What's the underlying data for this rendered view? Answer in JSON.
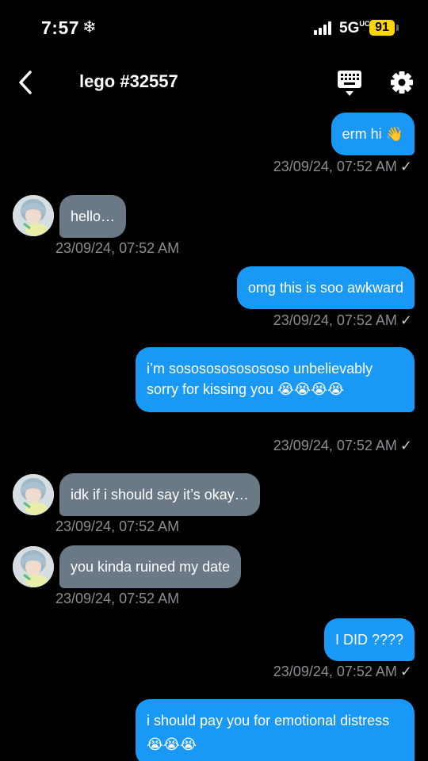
{
  "status": {
    "time": "7:57",
    "snow_glyph": "❄",
    "network": "5G",
    "network_sup": "UC",
    "battery": "91"
  },
  "header": {
    "title": "lego #32557",
    "back_icon": "chevron-left-icon",
    "keyboard_icon": "keyboard-icon",
    "settings_icon": "gear-icon"
  },
  "messages": [
    {
      "dir": "out",
      "text": "erm hi 👋",
      "time": "23/09/24, 07:52 AM",
      "read": "✓"
    },
    {
      "dir": "in",
      "text": "hello…",
      "time": "23/09/24, 07:52 AM"
    },
    {
      "dir": "out",
      "text": "omg this is soo awkward",
      "time": "23/09/24, 07:52 AM",
      "read": "✓"
    },
    {
      "dir": "out",
      "text": "i’m sosososososososo unbelievably sorry for kissing you 😭😭😭😭",
      "time": "23/09/24, 07:52 AM",
      "read": "✓"
    },
    {
      "dir": "in",
      "text": "idk if i should say it’s okay…",
      "time": "23/09/24, 07:52 AM"
    },
    {
      "dir": "in",
      "text": "you kinda ruined my date",
      "time": "23/09/24, 07:52 AM"
    },
    {
      "dir": "out",
      "text": "I DID ????",
      "time": "23/09/24, 07:52 AM",
      "read": "✓"
    },
    {
      "dir": "out",
      "text": "i should pay you for emotional distress 😭😭😭"
    }
  ],
  "colors": {
    "outgoing_bubble": "#1a98f5",
    "incoming_bubble": "#6b7886",
    "timestamp": "#8a8d92",
    "battery": "#ffd60a"
  }
}
